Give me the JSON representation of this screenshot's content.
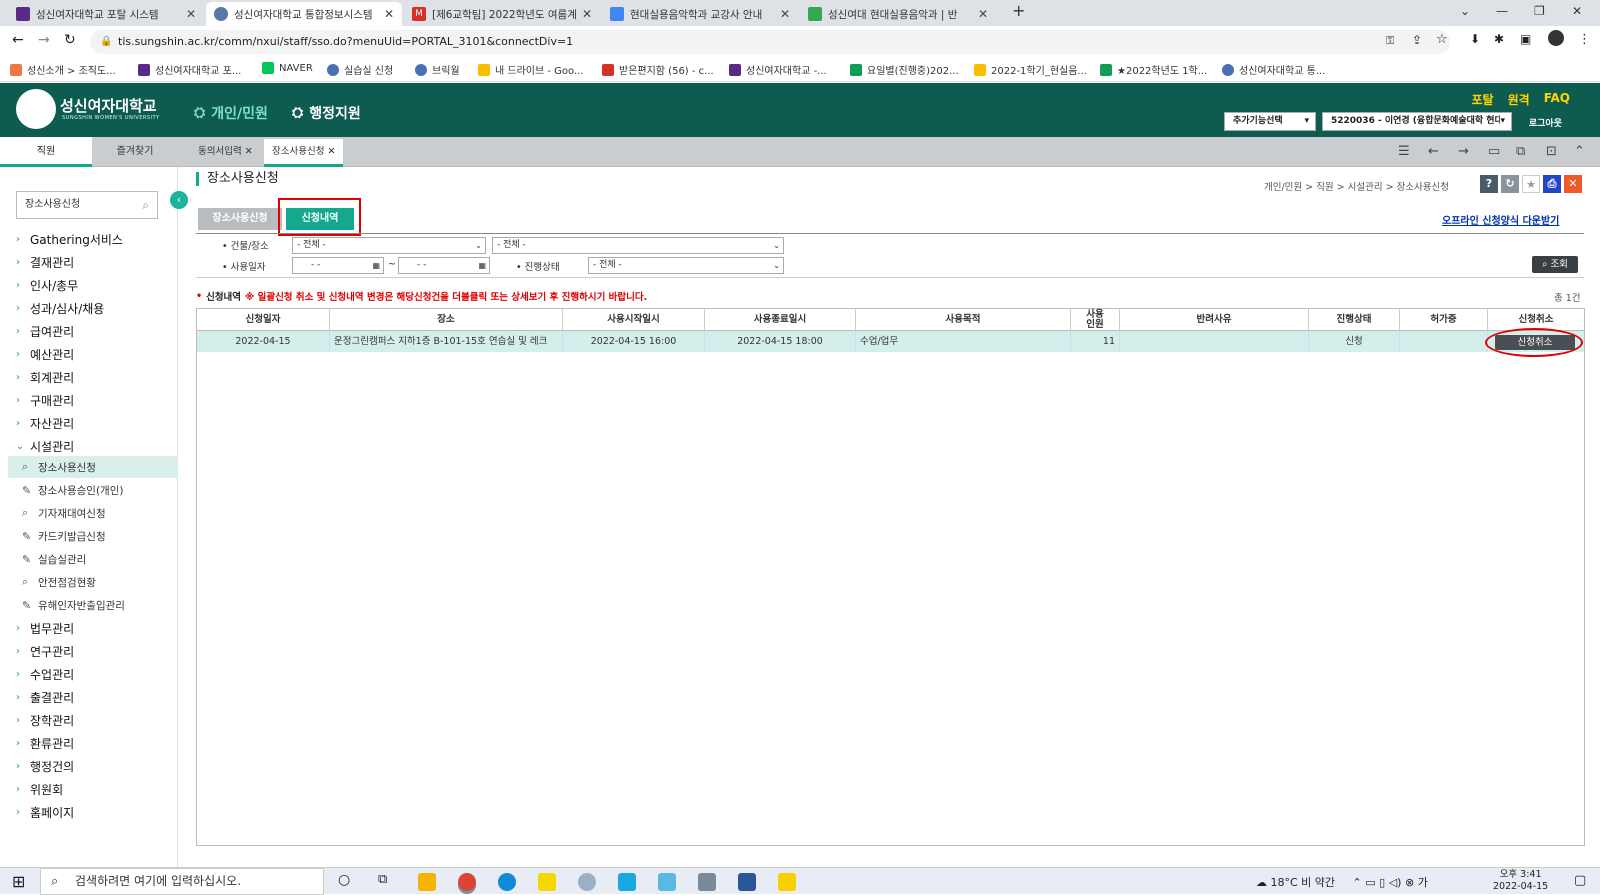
{
  "browser": {
    "tabs": [
      {
        "title": "성신여자대학교 포탈 시스템",
        "fav_color": "#5b2a86"
      },
      {
        "title": "성신여자대학교 통합정보시스템",
        "fav_color": "#5577aa"
      },
      {
        "title": "[제6교학팀] 2022학년도 여름계",
        "fav_color": "#d93025"
      },
      {
        "title": "현대실용음악학과 교강사 안내",
        "fav_color": "#4285f4"
      },
      {
        "title": "성신여대 현대실용음악과 | 반",
        "fav_color": "#34a853"
      }
    ],
    "url": "tis.sungshin.ac.kr/comm/nxui/staff/sso.do?menuUid=PORTAL_3101&connectDiv=1",
    "bookmarks": [
      "성신소개 > 조직도...",
      "성신여자대학교 포...",
      "NAVER",
      "실습실 신청",
      "브릭월",
      "내 드라이브 - Goo...",
      "받은편지함 (56) - c...",
      "성신여자대학교 -...",
      "요일별(진행중)202...",
      "2022-1학기_현실음...",
      "★2022학년도 1학...",
      "성신여자대학교 통..."
    ]
  },
  "header": {
    "logo": "성신여자대학교",
    "logo_sub": "SUNGSHIN WOMEN'S UNIVERSITY",
    "menu_personal": "개인/민원",
    "menu_admin": "행정지원",
    "links": [
      "포탈",
      "원격",
      "FAQ"
    ],
    "extra_select": "추가기능선택",
    "user_select": "5220036 - 이연경 (융합문화예술대학 현대",
    "logout": "로그아웃"
  },
  "tabrow": {
    "left_tabs": [
      "직원",
      "즐겨찾기"
    ],
    "open_tabs": [
      "동의서입력",
      "장소사용신청"
    ]
  },
  "sidebar": {
    "search_value": "장소사용신청",
    "menus_top": [
      "Gathering서비스",
      "결재관리",
      "인사/총무",
      "성과/심사/채용",
      "급여관리",
      "예산관리",
      "회계관리",
      "구매관리",
      "자산관리",
      "시설관리"
    ],
    "submenus": [
      "장소사용신청",
      "장소사용승인(개인)",
      "기자재대여신청",
      "카드키발급신청",
      "실습실관리",
      "안전점검현황",
      "유해인자반출입관리"
    ],
    "menus_bottom": [
      "법무관리",
      "연구관리",
      "수업관리",
      "출결관리",
      "장학관리",
      "환류관리",
      "행정건의",
      "위원회",
      "홈페이지"
    ]
  },
  "content": {
    "title": "장소사용신청",
    "breadcrumb": "개인/민원 > 직원 > 시설관리 > 장소사용신청",
    "subtab_apply": "장소사용신청",
    "subtab_history": "신청내역",
    "offline_link": "오프라인 신청양식 다운받기",
    "filter": {
      "building_label": "• 건물/장소",
      "building_value": "- 전체 -",
      "place_value": "- 전체 -",
      "date_label": "• 사용일자",
      "date_from": "- -",
      "date_tilde": "~",
      "date_to": "- -",
      "status_label": "• 진행상태",
      "status_value": "- 전체 -",
      "search_button": "조회"
    },
    "notice_head": "신청내역",
    "notice_text": "※ 일괄신청 취소 및 신청내역 변경은 해당신청건을 더블클릭 또는 상세보기 후 진행하시기 바랍니다.",
    "total": "총 1건",
    "grid": {
      "headers": [
        "신청일자",
        "장소",
        "사용시작일시",
        "사용종료일시",
        "사용목적",
        "사용\n인원",
        "반려사유",
        "진행상태",
        "허가증",
        "신청취소"
      ],
      "rows": [
        [
          "2022-04-15",
          "운정그린캠퍼스 지하1층 B-101-15호 연습실 및 레크",
          "2022-04-15 16:00",
          "2022-04-15 18:00",
          "수업/업무",
          "11",
          "",
          "신청",
          "",
          "신청취소"
        ]
      ]
    }
  },
  "taskbar": {
    "search_placeholder": "검색하려면 여기에 입력하십시오.",
    "weather": "18°C 비 약간",
    "time": "오후 3:41",
    "date": "2022-04-15"
  }
}
